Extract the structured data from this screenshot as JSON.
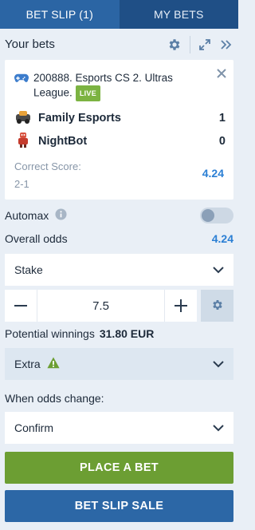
{
  "tabs": [
    {
      "label": "BET SLIP (1)",
      "active": true
    },
    {
      "label": "MY BETS",
      "active": false
    }
  ],
  "header": {
    "title": "Your bets"
  },
  "bet": {
    "event": "200888. Esports CS 2. Ultras League.",
    "live_badge": "LIVE",
    "teams": [
      {
        "name": "Family Esports",
        "score": "1",
        "icon": "team-logo-icon"
      },
      {
        "name": "NightBot",
        "score": "0",
        "icon": "team-logo-icon"
      }
    ],
    "market_label": "Correct Score:",
    "market_value": "2-1",
    "odds": "4.24"
  },
  "automax": {
    "label": "Automax",
    "enabled": false
  },
  "overall_odds": {
    "label": "Overall odds",
    "value": "4.24"
  },
  "stake_select": {
    "label": "Stake"
  },
  "stepper": {
    "value": "7.5"
  },
  "potential": {
    "label": "Potential winnings",
    "value": "31.80 EUR"
  },
  "extra_select": {
    "label": "Extra"
  },
  "odds_change": {
    "label": "When odds change:",
    "value": "Confirm"
  },
  "buttons": {
    "place": "PLACE A BET",
    "sale": "BET SLIP SALE"
  },
  "colors": {
    "tab_active": "#2b65a4",
    "tab_inactive": "#1f4f86",
    "odds_blue": "#2b7fd4",
    "place_green": "#6c9e33",
    "live_green": "#7cb342",
    "background": "#e9eff6"
  }
}
